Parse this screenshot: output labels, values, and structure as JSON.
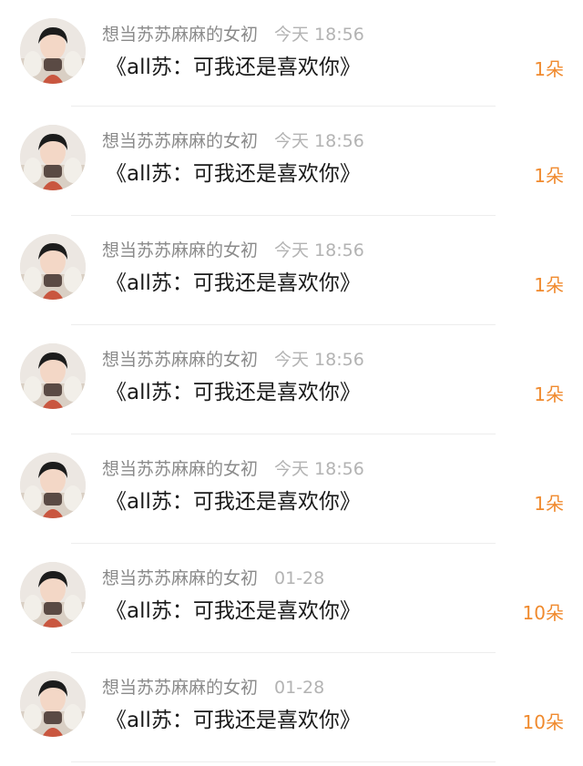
{
  "items": [
    {
      "name": "想当苏苏麻麻的女初",
      "time": "今天 18:56",
      "message": "《all苏：可我还是喜欢你》",
      "count": "1朵"
    },
    {
      "name": "想当苏苏麻麻的女初",
      "time": "今天 18:56",
      "message": "《all苏：可我还是喜欢你》",
      "count": "1朵"
    },
    {
      "name": "想当苏苏麻麻的女初",
      "time": "今天 18:56",
      "message": "《all苏：可我还是喜欢你》",
      "count": "1朵"
    },
    {
      "name": "想当苏苏麻麻的女初",
      "time": "今天 18:56",
      "message": "《all苏：可我还是喜欢你》",
      "count": "1朵"
    },
    {
      "name": "想当苏苏麻麻的女初",
      "time": "今天 18:56",
      "message": "《all苏：可我还是喜欢你》",
      "count": "1朵"
    },
    {
      "name": "想当苏苏麻麻的女初",
      "time": "01-28",
      "message": "《all苏：可我还是喜欢你》",
      "count": "10朵"
    },
    {
      "name": "想当苏苏麻麻的女初",
      "time": "01-28",
      "message": "《all苏：可我还是喜欢你》",
      "count": "10朵"
    }
  ],
  "colors": {
    "count": "#f08a2e",
    "name": "#8a8a8a",
    "time": "#b3b3b3",
    "message": "#1a1a1a"
  },
  "icons": {
    "avatar": "user-avatar-photo"
  }
}
